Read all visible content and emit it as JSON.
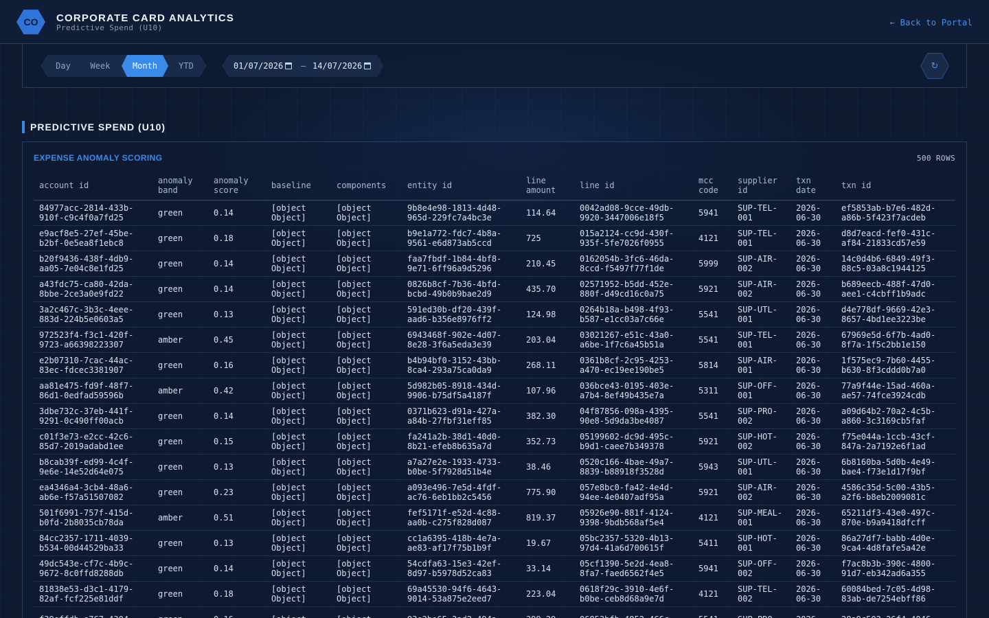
{
  "header": {
    "logo_text": "CO",
    "title": "CORPORATE CARD ANALYTICS",
    "subtitle": "Predictive Spend (U10)",
    "back_link": "← Back to Portal"
  },
  "controls": {
    "periods": [
      {
        "label": "Day",
        "active": false
      },
      {
        "label": "Week",
        "active": false
      },
      {
        "label": "Month",
        "active": true
      },
      {
        "label": "YTD",
        "active": false
      }
    ],
    "date_from": "01/07/2026",
    "date_to": "14/07/2026",
    "date_separator": "–",
    "refresh_icon": "↻"
  },
  "section": {
    "title": "PREDICTIVE SPEND (U10)"
  },
  "panel": {
    "title": "EXPENSE ANOMALY SCORING",
    "row_count": "500 ROWS"
  },
  "table": {
    "columns": [
      "account id",
      "anomaly\nband",
      "anomaly\nscore",
      "baseline",
      "components",
      "entity id",
      "line\namount",
      "line id",
      "mcc\ncode",
      "supplier\nid",
      "txn\ndate",
      "txn id"
    ],
    "rows": [
      [
        "84977acc-2814-433b-\n910f-c9c4f0a7fd25",
        "green",
        "0.14",
        "[object\nObject]",
        "[object\nObject]",
        "9b8e4e98-1813-4d48-\n965d-229fc7a4bc3e",
        "114.64",
        "0042ad08-9cce-49db-\n9920-3447006e18f5",
        "5941",
        "SUP-TEL-\n001",
        "2026-\n06-30",
        "ef5853ab-b7e6-482d-\na86b-5f423f7acdeb"
      ],
      [
        "e9acf8e5-27ef-45be-\nb2bf-0e5ea8f1ebc8",
        "green",
        "0.18",
        "[object\nObject]",
        "[object\nObject]",
        "b9e1a772-fdc7-4b8a-\n9561-e6d873ab5ccd",
        "725",
        "015a2124-cc9d-430f-\n935f-5fe7026f0955",
        "4121",
        "SUP-TEL-\n001",
        "2026-\n06-30",
        "d8d7eacd-fef0-431c-\naf84-21833cd57e59"
      ],
      [
        "b20f9436-438f-4db9-\naa05-7e04c8e1fd25",
        "green",
        "0.14",
        "[object\nObject]",
        "[object\nObject]",
        "faa7fbdf-1b84-4bf8-\n9e71-6ff96a9d5296",
        "210.45",
        "0162054b-3fc6-46da-\n8ccd-f5497f77f1de",
        "5999",
        "SUP-AIR-\n002",
        "2026-\n06-30",
        "14c0d4b6-6849-49f3-\n88c5-03a8c1944125"
      ],
      [
        "a43fdc75-ca80-42da-\n8bbe-2ce3a0e9fd22",
        "green",
        "0.14",
        "[object\nObject]",
        "[object\nObject]",
        "0826b8cf-7b36-4bfd-\nbcbd-49b0b9bae2d9",
        "435.70",
        "02571952-b5dd-452e-\n880f-d49cd16c0a75",
        "5921",
        "SUP-AIR-\n002",
        "2026-\n06-30",
        "b689eecb-488f-47d0-\naee1-c4cbff1b9adc"
      ],
      [
        "3a2c467c-3b3c-4eee-\n883d-224b5e0603a5",
        "green",
        "0.13",
        "[object\nObject]",
        "[object\nObject]",
        "591ed30b-df20-439f-\naad6-b356e8976ff2",
        "124.98",
        "0264b18a-b498-4f93-\nb587-e1cc03a7c66e",
        "5541",
        "SUP-UTL-\n001",
        "2026-\n06-30",
        "d4e778df-9669-42e3-\n8657-4bd1ee3223be"
      ],
      [
        "972523f4-f3c1-420f-\n9723-a66398223307",
        "amber",
        "0.45",
        "[object\nObject]",
        "[object\nObject]",
        "6943468f-902e-4d07-\n8e28-3f6a5eda3e39",
        "203.04",
        "03021267-e51c-43a0-\na6be-1f7c6a45b51a",
        "5541",
        "SUP-TEL-\n001",
        "2026-\n06-30",
        "67969e5d-6f7b-4ad0-\n8f7a-1f5c2bb1e150"
      ],
      [
        "e2b07310-7cac-44ac-\n83ec-fdcec3381907",
        "green",
        "0.16",
        "[object\nObject]",
        "[object\nObject]",
        "b4b94bf0-3152-43bb-\n8ca4-293a75ca0da9",
        "268.11",
        "0361b8cf-2c95-4253-\na470-ec19ee190be5",
        "5814",
        "SUP-AIR-\n001",
        "2026-\n06-30",
        "1f575ec9-7b60-4455-\nb630-8f3cddd0b7a0"
      ],
      [
        "aa81e475-fd9f-48f7-\n86d1-0edfad59596b",
        "amber",
        "0.42",
        "[object\nObject]",
        "[object\nObject]",
        "5d982b05-8918-434d-\n9906-b75df5a4187f",
        "107.96",
        "036bce43-0195-403e-\na7b4-8ef49b435e7a",
        "5311",
        "SUP-OFF-\n001",
        "2026-\n06-30",
        "77a9f44e-15ad-460a-\nae57-74fce3924cdb"
      ],
      [
        "3dbe732c-37eb-441f-\n9291-0c490ff00acb",
        "green",
        "0.14",
        "[object\nObject]",
        "[object\nObject]",
        "0371b623-d91a-427a-\na84b-27fbf31eff85",
        "382.30",
        "04f87856-098a-4395-\n90e8-5d9da3be4087",
        "5541",
        "SUP-PRO-\n002",
        "2026-\n06-30",
        "a09d64b2-70a2-4c5b-\na860-3c3169cb5faf"
      ],
      [
        "c01f3e73-e2cc-42c6-\n85d7-2019adabd1ee",
        "green",
        "0.15",
        "[object\nObject]",
        "[object\nObject]",
        "fa241a2b-38d1-40d0-\n8b21-efeb8b635a7d",
        "352.73",
        "05199602-dc9d-495c-\nb9d1-caee7b349378",
        "5921",
        "SUP-HOT-\n002",
        "2026-\n06-30",
        "f75e044a-1ccb-43cf-\n847a-2a7192e6f1ad"
      ],
      [
        "b8cab39f-ed99-4c4f-\n9e6e-14e52d64e075",
        "green",
        "0.13",
        "[object\nObject]",
        "[object\nObject]",
        "a7a27e2e-1933-4733-\nb0be-5f7928d51b4e",
        "38.46",
        "0520c166-4bae-49a7-\n8839-b88918f3528d",
        "5943",
        "SUP-UTL-\n001",
        "2026-\n06-30",
        "6b8160ba-5d0b-4e49-\nbae4-f73e1d17f9bf"
      ],
      [
        "ea4346a4-3cb4-48a6-\nab6e-f57a51507082",
        "green",
        "0.23",
        "[object\nObject]",
        "[object\nObject]",
        "a093e496-7e5d-4fdf-\nac76-6eb1bb2c5456",
        "775.90",
        "057e8bc0-fa42-4e4d-\n94ee-4e0407adf95a",
        "5921",
        "SUP-AIR-\n002",
        "2026-\n06-30",
        "4586c35d-5c00-43b5-\na2f6-b8eb2009081c"
      ],
      [
        "501f6991-757f-415d-\nb0fd-2b8035cb78da",
        "amber",
        "0.51",
        "[object\nObject]",
        "[object\nObject]",
        "fef5171f-e52d-4c88-\naa0b-c275f828d087",
        "819.37",
        "05926e90-881f-4124-\n9398-9bdb568af5e4",
        "4121",
        "SUP-MEAL-\n001",
        "2026-\n06-30",
        "65211df3-43e0-497c-\n870e-b9a9418dfcff"
      ],
      [
        "84cc2357-1711-4039-\nb534-00d44529ba33",
        "green",
        "0.13",
        "[object\nObject]",
        "[object\nObject]",
        "cc1a6395-418b-4e7a-\nae83-af17f75b1b9f",
        "19.67",
        "05bc2357-5320-4b13-\n97d4-41a6d700615f",
        "5411",
        "SUP-HOT-\n001",
        "2026-\n06-30",
        "86a27df7-babb-4d0e-\n9ca4-4d8fafe5a42e"
      ],
      [
        "49dc543e-cf7c-4b9c-\n9672-8c0ffd8288db",
        "green",
        "0.14",
        "[object\nObject]",
        "[object\nObject]",
        "54cdfa63-15e3-42ef-\n8d97-b5978d52ca83",
        "33.14",
        "05cf1390-5e2d-4ea8-\n8fa7-faed6562f4e5",
        "5941",
        "SUP-OFF-\n002",
        "2026-\n06-30",
        "f7ac8b3b-390c-4800-\n91d7-eb342ad6a355"
      ],
      [
        "81838e53-d3c1-4179-\n82af-fcf225e81ddf",
        "green",
        "0.18",
        "[object\nObject]",
        "[object\nObject]",
        "69a45530-94f6-4643-\n9014-53a875e2eed7",
        "223.04",
        "0618f29c-3910-4e6f-\nb0be-ceb8d68a9e7d",
        "4121",
        "SUP-TEL-\n002",
        "2026-\n06-30",
        "60084bed-7c05-4d98-\n83ab-de7254ebff86"
      ],
      [
        "f39effdb-e767-4304-\n",
        "green",
        "0.16",
        "[object\n",
        "[object\n",
        "93e3be65-3ad2-494a-\n",
        "399.29",
        "06853bfb-4852-466c-\n",
        "5541",
        "SUP-PRO-\n",
        "2026-\n",
        "28a9c502-26f4-4046-\n"
      ]
    ]
  }
}
